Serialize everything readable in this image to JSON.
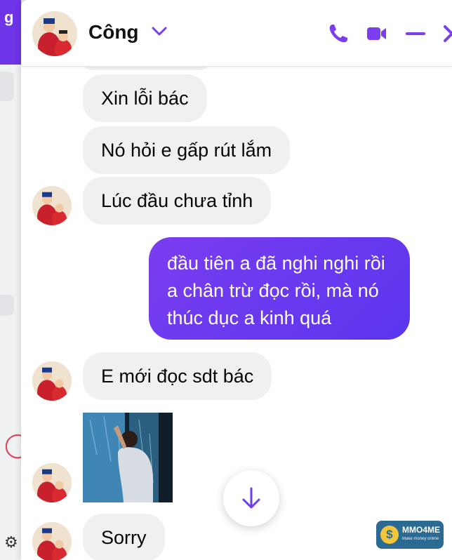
{
  "conversation": {
    "contact_name": "Công"
  },
  "messages": [
    {
      "side": "received",
      "text": "Xin lỗi bác"
    },
    {
      "side": "received",
      "text": "Nó hỏi e gấp rút lắm"
    },
    {
      "side": "received",
      "text": "Lúc đầu chưa tỉnh"
    },
    {
      "side": "sent",
      "text": "đầu tiên a đã nghi nghi rồi a chân trừ đọc rồi, mà nó thúc dục a kinh quá"
    },
    {
      "side": "received",
      "text": "E mới đọc sdt bác"
    },
    {
      "side": "received",
      "text": "Sorry"
    }
  ],
  "background_app": {
    "partial_text": "g"
  },
  "watermark": {
    "brand": "MMO4ME",
    "tagline": "Make money online",
    "symbol": "$"
  },
  "colors": {
    "accent": "#7b3df0",
    "sent_bubble": "#5a35ee",
    "received_bubble": "#f0f0f0"
  },
  "icons": [
    "phone-icon",
    "video-icon",
    "minimize-icon",
    "close-icon",
    "chevron-down-icon",
    "arrow-down-icon"
  ]
}
